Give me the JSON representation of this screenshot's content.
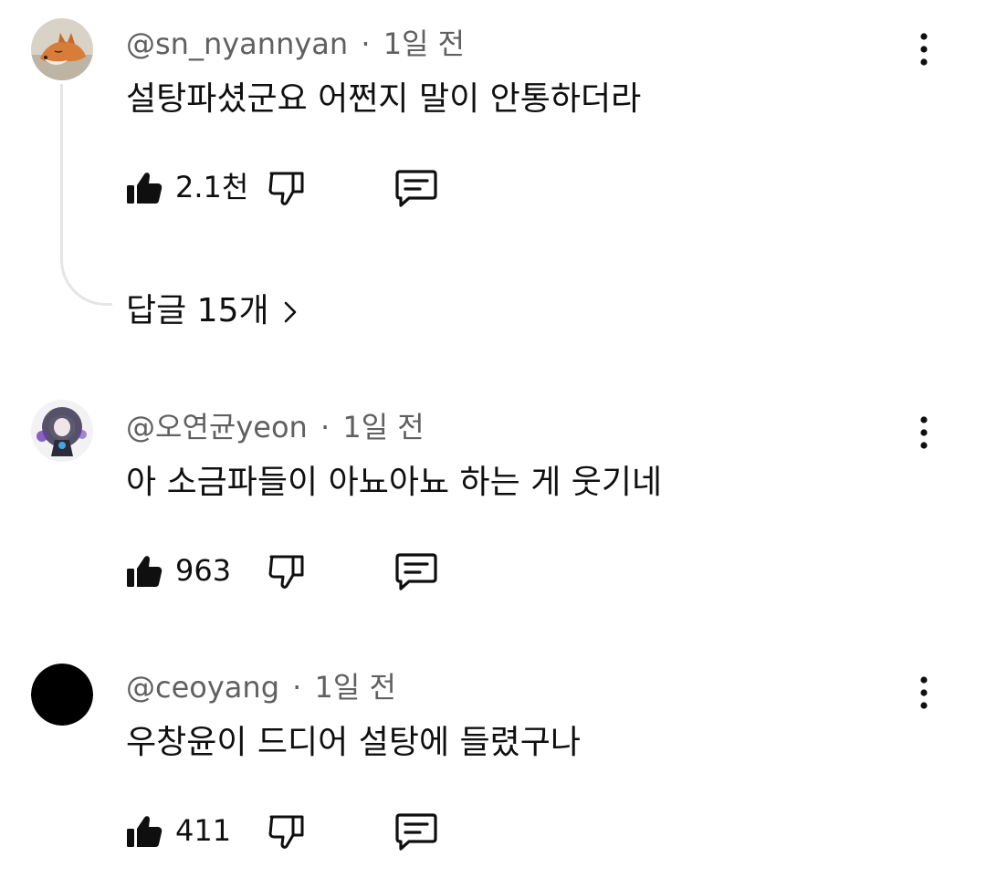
{
  "comments": [
    {
      "handle": "@sn_nyannyan",
      "separator": "·",
      "time": "1일 전",
      "text": "설탕파셨군요 어쩐지 말이 안통하더라",
      "likes": "2.1천",
      "avatar_icon": "fox-avatar",
      "replies_label": "답글 15개"
    },
    {
      "handle": "@오연균yeon",
      "separator": "·",
      "time": "1일 전",
      "text": "아 소금파들이 아뇨아뇨 하는 게 웃기네",
      "likes": "963",
      "avatar_icon": "character-avatar"
    },
    {
      "handle": "@ceoyang",
      "separator": "·",
      "time": "1일 전",
      "text": "우창윤이 드디어 설탕에 들렸구나",
      "likes": "411",
      "avatar_icon": "black-circle-avatar"
    }
  ],
  "icons": {
    "like": "thumbs-up-icon",
    "dislike": "thumbs-down-icon",
    "reply": "comment-icon",
    "more": "more-vertical-icon",
    "chevron": "chevron-right-icon"
  },
  "colors": {
    "text": "#0f0f0f",
    "meta": "#606060",
    "thread_line": "#e5e5e5"
  }
}
